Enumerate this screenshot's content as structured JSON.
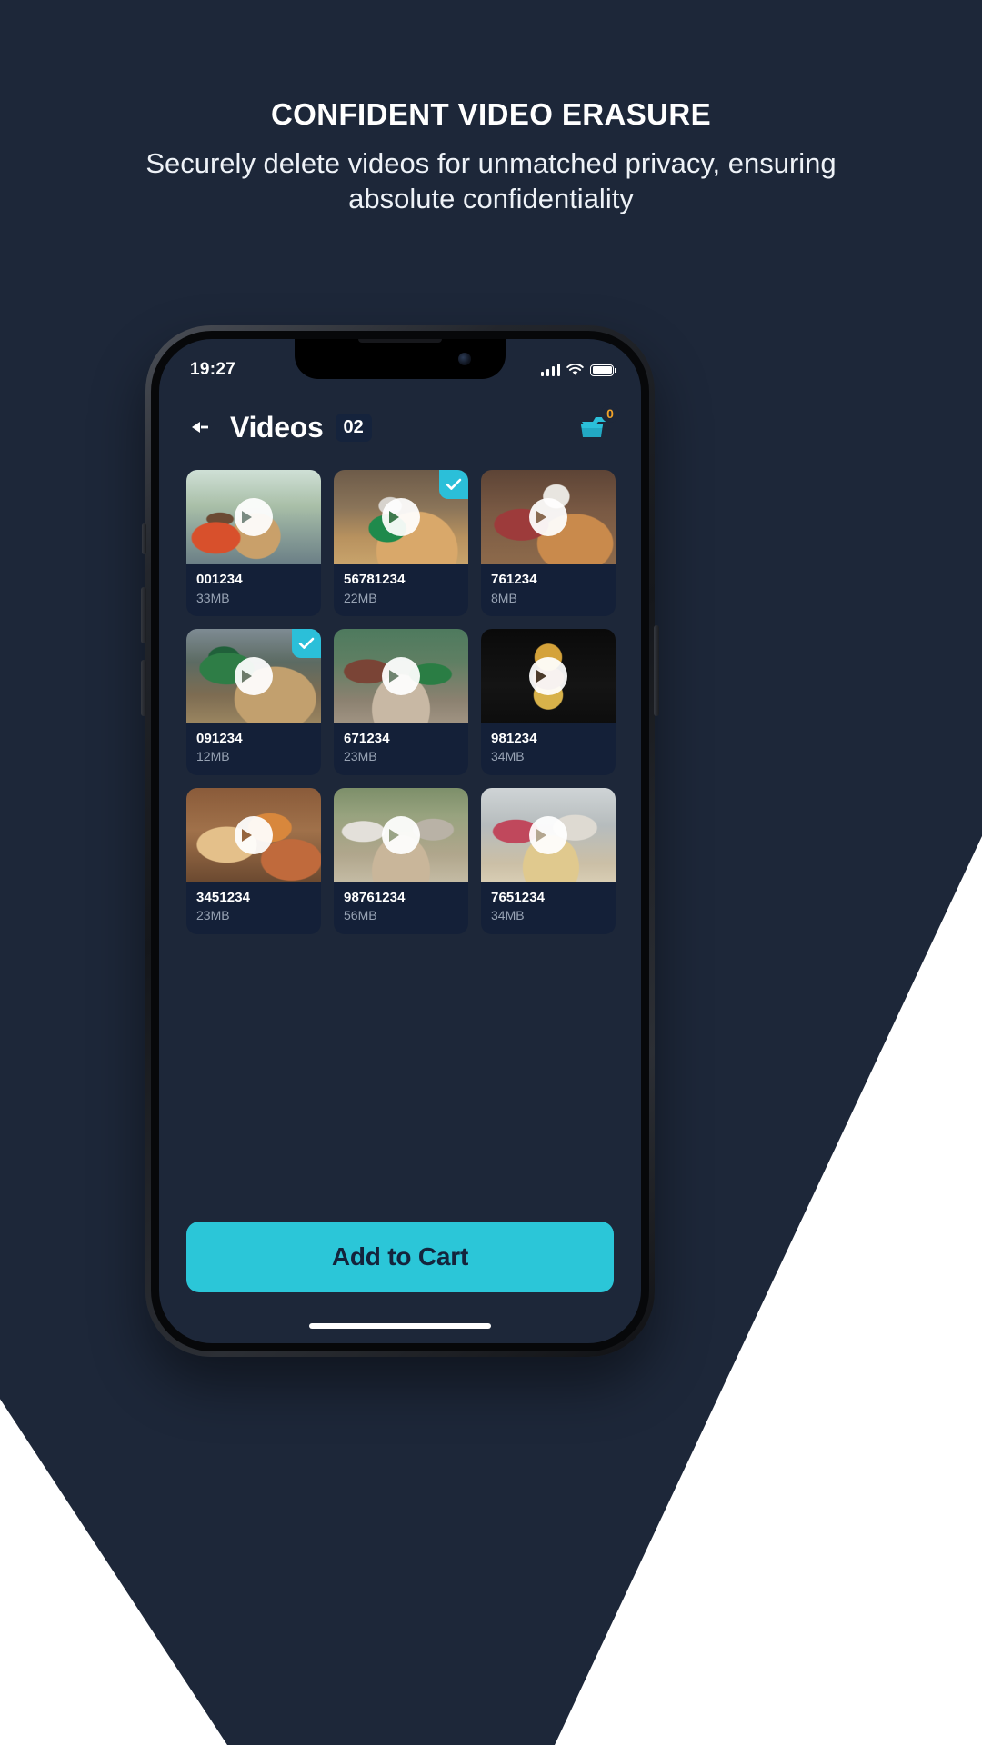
{
  "promo": {
    "title": "CONFIDENT VIDEO ERASURE",
    "subtitle": "Securely delete videos for unmatched privacy, ensuring absolute confidentiality"
  },
  "colors": {
    "background_navy": "#1d2739",
    "accent_cyan": "#2bc6d8",
    "card_navy": "#142038",
    "badge_orange": "#f0a228"
  },
  "status_bar": {
    "time": "19:27",
    "signal_icon": "signal-bars-icon",
    "wifi_icon": "wifi-icon",
    "battery_icon": "battery-icon"
  },
  "header": {
    "back_icon": "back-arrow-icon",
    "title": "Videos",
    "count_badge": "02",
    "cart_icon": "shopping-cart-icon",
    "cart_count": "0"
  },
  "videos": [
    {
      "name": "001234",
      "size": "33MB",
      "selected": false,
      "scene": "s1"
    },
    {
      "name": "56781234",
      "size": "22MB",
      "selected": true,
      "scene": "s2"
    },
    {
      "name": "761234",
      "size": "8MB",
      "selected": false,
      "scene": "s3"
    },
    {
      "name": "091234",
      "size": "12MB",
      "selected": true,
      "scene": "s4"
    },
    {
      "name": "671234",
      "size": "23MB",
      "selected": false,
      "scene": "s5"
    },
    {
      "name": "981234",
      "size": "34MB",
      "selected": false,
      "scene": "s6"
    },
    {
      "name": "3451234",
      "size": "23MB",
      "selected": false,
      "scene": "s7"
    },
    {
      "name": "98761234",
      "size": "56MB",
      "selected": false,
      "scene": "s8"
    },
    {
      "name": "7651234",
      "size": "34MB",
      "selected": false,
      "scene": "s9"
    }
  ],
  "cta": {
    "label": "Add to Cart"
  }
}
